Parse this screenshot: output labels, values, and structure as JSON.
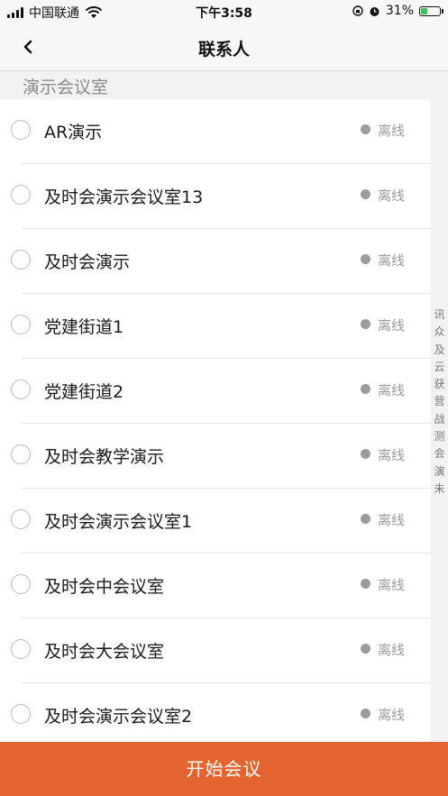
{
  "status_bar": {
    "carrier": "中国联通",
    "time": "下午3:58",
    "battery_percent": "31%",
    "battery_level": 0.31
  },
  "nav": {
    "title": "联系人",
    "back_icon": "chevron-left-icon"
  },
  "section": {
    "title": "演示会议室"
  },
  "contacts": [
    {
      "name": "AR演示",
      "status": "离线"
    },
    {
      "name": "及时会演示会议室13",
      "status": "离线"
    },
    {
      "name": "及时会演示",
      "status": "离线"
    },
    {
      "name": "党建街道1",
      "status": "离线"
    },
    {
      "name": "党建街道2",
      "status": "离线"
    },
    {
      "name": "及时会教学演示",
      "status": "离线"
    },
    {
      "name": "及时会演示会议室1",
      "status": "离线"
    },
    {
      "name": "及时会中会议室",
      "status": "离线"
    },
    {
      "name": "及时会大会议室",
      "status": "离线"
    },
    {
      "name": "及时会演示会议室2",
      "status": "离线"
    }
  ],
  "index_letters": [
    "讯",
    "众",
    "及",
    "云",
    "获",
    "营",
    "战",
    "测",
    "会",
    "演",
    "未"
  ],
  "actions": {
    "start_meeting": "开始会议"
  },
  "colors": {
    "accent": "#e3642e",
    "offline_dot": "#9b9b9b",
    "battery_fill": "#34c759"
  }
}
